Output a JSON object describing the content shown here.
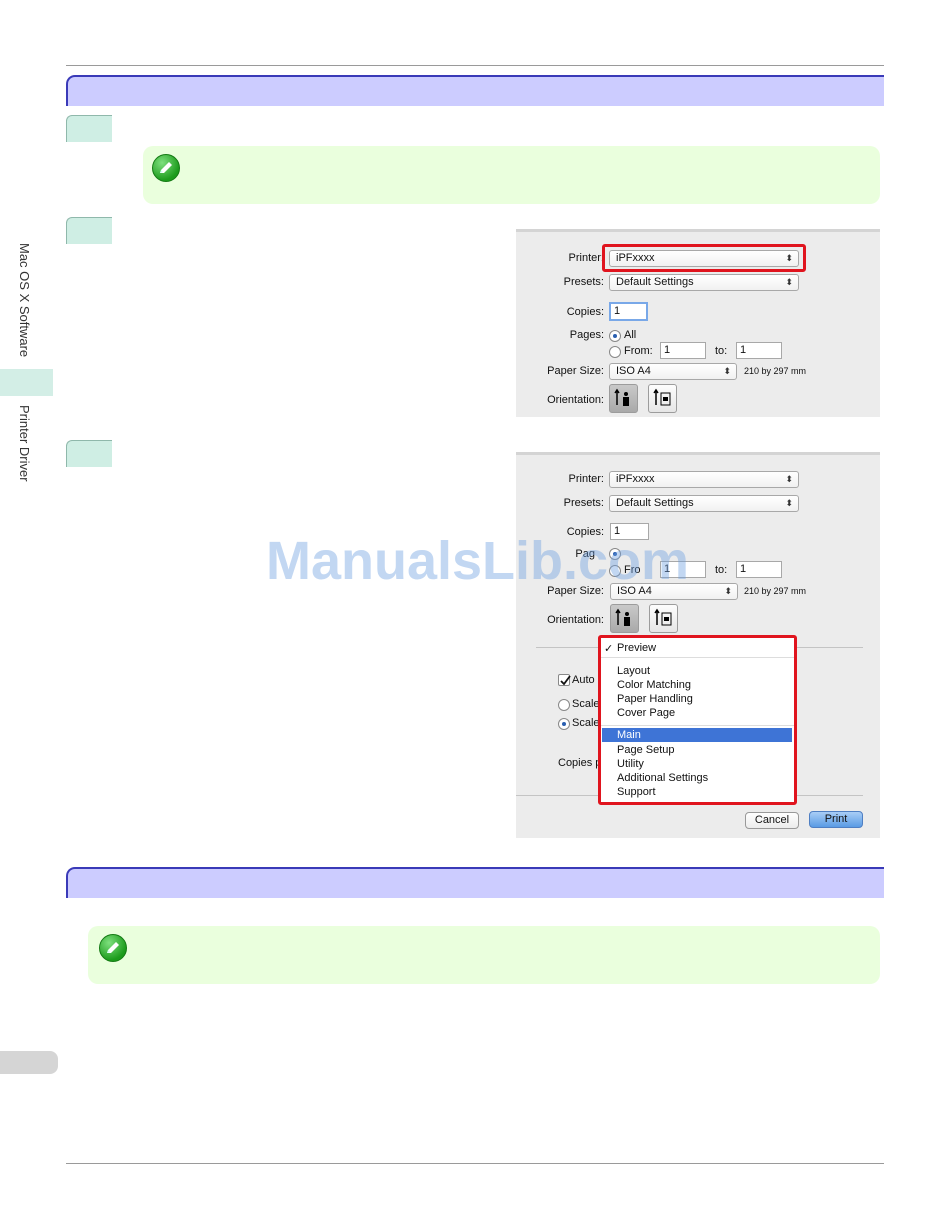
{
  "sidebar": {
    "section_mac": "Mac OS X Software",
    "section_driver": "Printer Driver"
  },
  "dialog1": {
    "printer_label": "Printer:",
    "printer_value": "iPFxxxx",
    "presets_label": "Presets:",
    "presets_value": "Default Settings",
    "copies_label": "Copies:",
    "copies_value": "1",
    "pages_label": "Pages:",
    "pages_all": "All",
    "pages_from": "From:",
    "from_value": "1",
    "to_label": "to:",
    "to_value": "1",
    "paper_size_label": "Paper Size:",
    "paper_size_value": "ISO A4",
    "paper_dims": "210 by 297 mm",
    "orientation_label": "Orientation:"
  },
  "dialog2": {
    "printer_label": "Printer:",
    "printer_value": "iPFxxxx",
    "presets_label": "Presets:",
    "presets_value": "Default Settings",
    "copies_label": "Copies:",
    "copies_value": "1",
    "pages_label": "Pag",
    "pages_from": "Fro",
    "from_value": "1",
    "to_label": "to:",
    "to_value": "1",
    "paper_size_label": "Paper Size:",
    "paper_size_value": "ISO A4",
    "paper_dims": "210 by 297 mm",
    "orientation_label": "Orientation:",
    "auto_label": "Auto",
    "scale1_label": "Scale",
    "scale2_label": "Scale",
    "copies_per_label": "Copies p",
    "cancel_button": "Cancel",
    "print_button": "Print",
    "menu": {
      "checked_item": "Preview",
      "items": [
        "Layout",
        "Color Matching",
        "Paper Handling",
        "Cover Page"
      ],
      "selected_item": "Main",
      "items_after": [
        "Page Setup",
        "Utility",
        "Additional Settings",
        "Support"
      ]
    }
  },
  "watermark": "ManualsLib.com",
  "colors": {
    "section_bar": "#ccccff",
    "note_bg": "#eaffdd",
    "highlight_red": "#e0141e",
    "menu_selected": "#3e74d6"
  }
}
